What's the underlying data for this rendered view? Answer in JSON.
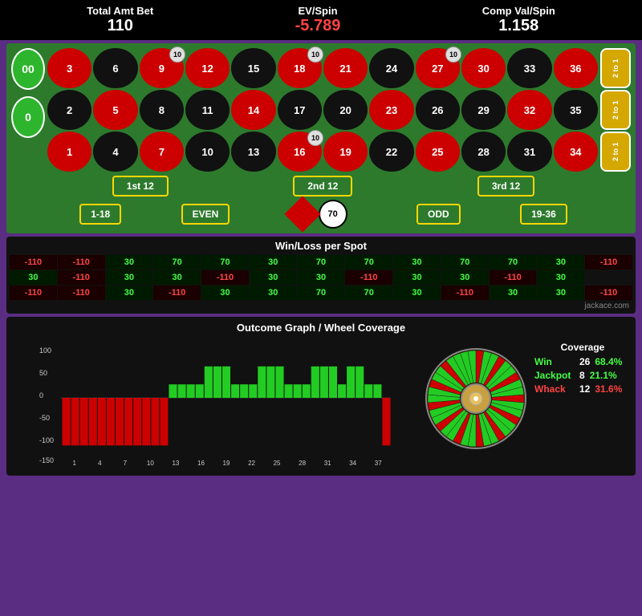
{
  "header": {
    "total_amt_bet_label": "Total Amt Bet",
    "total_amt_bet_value": "110",
    "ev_spin_label": "EV/Spin",
    "ev_spin_value": "-5.789",
    "comp_val_label": "Comp Val/Spin",
    "comp_val_value": "1.158"
  },
  "table": {
    "zeros": [
      "00",
      "0"
    ],
    "numbers": [
      {
        "n": "3",
        "color": "red",
        "row": 0,
        "col": 0
      },
      {
        "n": "6",
        "color": "black",
        "row": 0,
        "col": 1
      },
      {
        "n": "9",
        "color": "red",
        "row": 0,
        "col": 2,
        "chip": "10"
      },
      {
        "n": "12",
        "color": "red",
        "row": 0,
        "col": 3
      },
      {
        "n": "15",
        "color": "black",
        "row": 0,
        "col": 4
      },
      {
        "n": "18",
        "color": "red",
        "row": 0,
        "col": 5,
        "chip": "10"
      },
      {
        "n": "21",
        "color": "red",
        "row": 0,
        "col": 6
      },
      {
        "n": "24",
        "color": "black",
        "row": 0,
        "col": 7
      },
      {
        "n": "27",
        "color": "red",
        "row": 0,
        "col": 8,
        "chip": "10"
      },
      {
        "n": "30",
        "color": "red",
        "row": 0,
        "col": 9
      },
      {
        "n": "33",
        "color": "black",
        "row": 0,
        "col": 10
      },
      {
        "n": "36",
        "color": "red",
        "row": 0,
        "col": 11
      },
      {
        "n": "2",
        "color": "black",
        "row": 1,
        "col": 0
      },
      {
        "n": "5",
        "color": "red",
        "row": 1,
        "col": 1
      },
      {
        "n": "8",
        "color": "black",
        "row": 1,
        "col": 2
      },
      {
        "n": "11",
        "color": "black",
        "row": 1,
        "col": 3
      },
      {
        "n": "14",
        "color": "red",
        "row": 1,
        "col": 4
      },
      {
        "n": "17",
        "color": "black",
        "row": 1,
        "col": 5
      },
      {
        "n": "20",
        "color": "black",
        "row": 1,
        "col": 6
      },
      {
        "n": "23",
        "color": "red",
        "row": 1,
        "col": 7
      },
      {
        "n": "26",
        "color": "black",
        "row": 1,
        "col": 8
      },
      {
        "n": "29",
        "color": "black",
        "row": 1,
        "col": 9
      },
      {
        "n": "32",
        "color": "red",
        "row": 1,
        "col": 10
      },
      {
        "n": "35",
        "color": "black",
        "row": 1,
        "col": 11
      },
      {
        "n": "1",
        "color": "red",
        "row": 2,
        "col": 0
      },
      {
        "n": "4",
        "color": "black",
        "row": 2,
        "col": 1
      },
      {
        "n": "7",
        "color": "red",
        "row": 2,
        "col": 2
      },
      {
        "n": "10",
        "color": "black",
        "row": 2,
        "col": 3
      },
      {
        "n": "13",
        "color": "black",
        "row": 2,
        "col": 4
      },
      {
        "n": "16",
        "color": "red",
        "row": 2,
        "col": 5,
        "chip": "10"
      },
      {
        "n": "19",
        "color": "red",
        "row": 2,
        "col": 6
      },
      {
        "n": "22",
        "color": "black",
        "row": 2,
        "col": 7
      },
      {
        "n": "25",
        "color": "red",
        "row": 2,
        "col": 8
      },
      {
        "n": "28",
        "color": "black",
        "row": 2,
        "col": 9
      },
      {
        "n": "31",
        "color": "black",
        "row": 2,
        "col": 10
      },
      {
        "n": "34",
        "color": "red",
        "row": 2,
        "col": 11
      }
    ],
    "dozens": [
      "1st 12",
      "2nd 12",
      "3rd 12"
    ],
    "even_money": [
      "1-18",
      "EVEN",
      "ODD",
      "19-36"
    ],
    "ball_value": "70",
    "two_to_one": [
      "2 to 1",
      "2 to 1",
      "2 to 1"
    ]
  },
  "winloss": {
    "title": "Win/Loss per Spot",
    "rows": [
      [
        "-110",
        "-110",
        "30",
        "70",
        "70",
        "30",
        "70",
        "70",
        "30",
        "70",
        "70",
        "30",
        "-110"
      ],
      [
        "30",
        "-110",
        "30",
        "30",
        "-110",
        "30",
        "30",
        "-110",
        "30",
        "30",
        "-110",
        "30",
        ""
      ],
      [
        "-110",
        "-110",
        "30",
        "-110",
        "30",
        "30",
        "70",
        "70",
        "30",
        "-110",
        "30",
        "30",
        "-110"
      ]
    ],
    "credit": "jackace.com"
  },
  "outcome": {
    "title": "Outcome Graph / Wheel Coverage",
    "x_labels": [
      "1",
      "4",
      "7",
      "10",
      "13",
      "16",
      "19",
      "22",
      "25",
      "28",
      "31",
      "34",
      "37"
    ],
    "bars": [
      {
        "x": 1,
        "v": -110,
        "color": "red"
      },
      {
        "x": 2,
        "v": -110,
        "color": "red"
      },
      {
        "x": 3,
        "v": -110,
        "color": "red"
      },
      {
        "x": 4,
        "v": -110,
        "color": "red"
      },
      {
        "x": 5,
        "v": -110,
        "color": "red"
      },
      {
        "x": 6,
        "v": -110,
        "color": "red"
      },
      {
        "x": 7,
        "v": -110,
        "color": "red"
      },
      {
        "x": 8,
        "v": -110,
        "color": "red"
      },
      {
        "x": 9,
        "v": -110,
        "color": "red"
      },
      {
        "x": 10,
        "v": -110,
        "color": "red"
      },
      {
        "x": 11,
        "v": -110,
        "color": "red"
      },
      {
        "x": 12,
        "v": -110,
        "color": "red"
      },
      {
        "x": 13,
        "v": 30,
        "color": "green"
      },
      {
        "x": 14,
        "v": 30,
        "color": "green"
      },
      {
        "x": 15,
        "v": 30,
        "color": "green"
      },
      {
        "x": 16,
        "v": 30,
        "color": "green"
      },
      {
        "x": 17,
        "v": 70,
        "color": "green"
      },
      {
        "x": 18,
        "v": 70,
        "color": "green"
      },
      {
        "x": 19,
        "v": 70,
        "color": "green"
      },
      {
        "x": 20,
        "v": 30,
        "color": "green"
      },
      {
        "x": 21,
        "v": 30,
        "color": "green"
      },
      {
        "x": 22,
        "v": 30,
        "color": "green"
      },
      {
        "x": 23,
        "v": 70,
        "color": "green"
      },
      {
        "x": 24,
        "v": 70,
        "color": "green"
      },
      {
        "x": 25,
        "v": 70,
        "color": "green"
      },
      {
        "x": 26,
        "v": 30,
        "color": "green"
      },
      {
        "x": 27,
        "v": 30,
        "color": "green"
      },
      {
        "x": 28,
        "v": 30,
        "color": "green"
      },
      {
        "x": 29,
        "v": 70,
        "color": "green"
      },
      {
        "x": 30,
        "v": 70,
        "color": "green"
      },
      {
        "x": 31,
        "v": 70,
        "color": "green"
      },
      {
        "x": 32,
        "v": 30,
        "color": "green"
      },
      {
        "x": 33,
        "v": 70,
        "color": "green"
      },
      {
        "x": 34,
        "v": 70,
        "color": "green"
      },
      {
        "x": 35,
        "v": 30,
        "color": "green"
      },
      {
        "x": 36,
        "v": 30,
        "color": "green"
      },
      {
        "x": 37,
        "v": -110,
        "color": "red"
      }
    ],
    "y_labels": [
      "100",
      "50",
      "0",
      "-50",
      "-100",
      "-150"
    ],
    "coverage": {
      "title": "Coverage",
      "win_label": "Win",
      "win_count": "26",
      "win_pct": "68.4%",
      "jackpot_label": "Jackpot",
      "jackpot_count": "8",
      "jackpot_pct": "21.1%",
      "whack_label": "Whack",
      "whack_count": "12",
      "whack_pct": "31.6%"
    }
  }
}
